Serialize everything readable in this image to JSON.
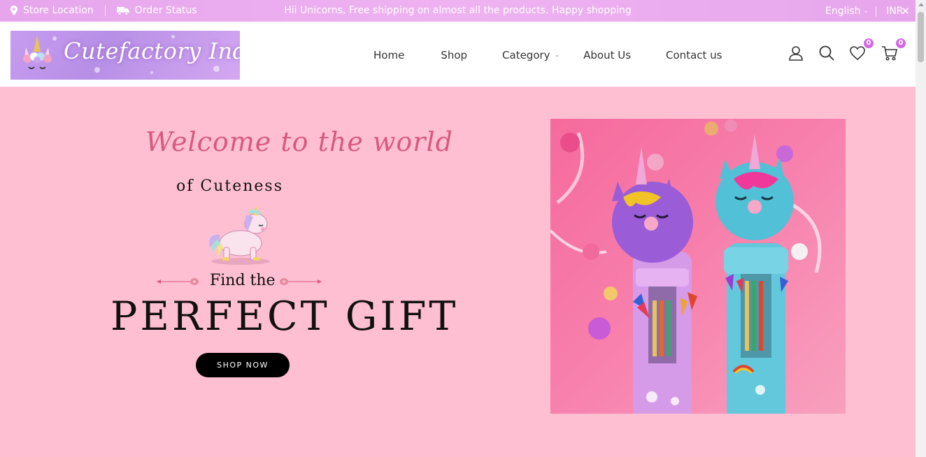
{
  "topbar": {
    "store_location": "Store Location",
    "order_status": "Order Status",
    "announcement": "Hii Unicorns, Free shipping on almost all the products. Happy shopping",
    "language": "English",
    "currency": "INR",
    "background_color": "#eaa9ee"
  },
  "header": {
    "logo_text": "Cutefactory India",
    "nav": [
      {
        "label": "Home"
      },
      {
        "label": "Shop"
      },
      {
        "label": "Category"
      },
      {
        "label": "About Us"
      },
      {
        "label": "Contact us"
      }
    ],
    "wishlist_count": "0",
    "cart_count": "0",
    "badge_color": "#d567e4"
  },
  "hero": {
    "welcome": "Welcome to the world",
    "cuteness": "of Cuteness",
    "find_the": "Find the",
    "headline": "PERFECT GIFT",
    "cta_label": "SHOP NOW",
    "background_color": "#ffbfd3",
    "accent_color": "#d75a7e"
  }
}
